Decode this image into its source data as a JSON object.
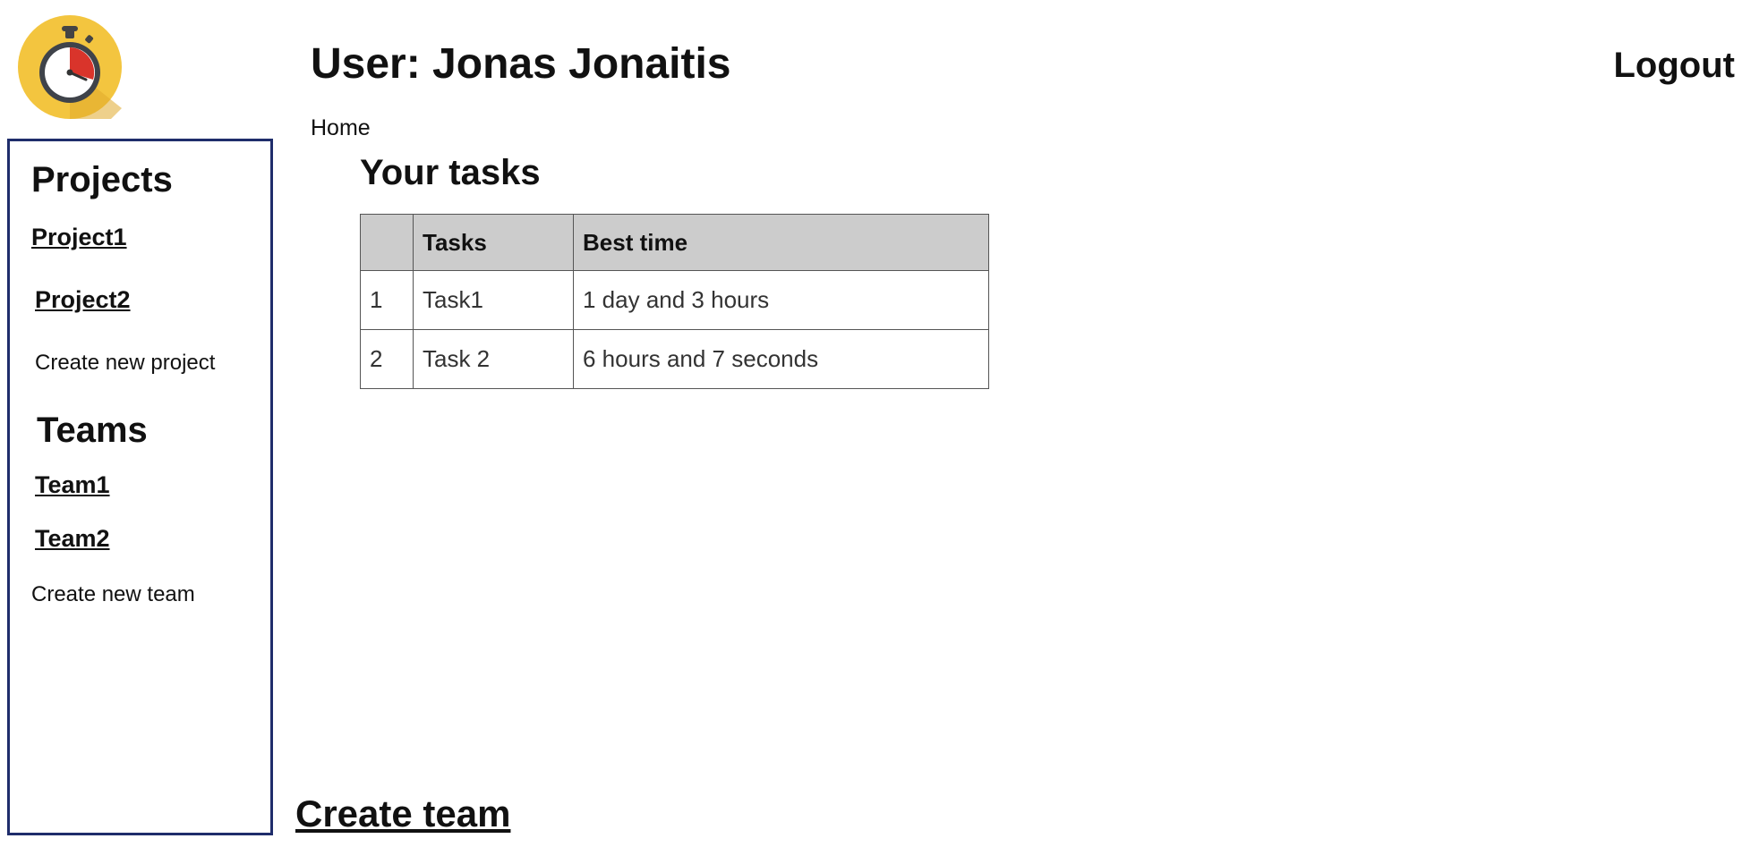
{
  "header": {
    "user_title": "User: Jonas Jonaitis",
    "logout_label": "Logout"
  },
  "breadcrumb": {
    "home_label": "Home"
  },
  "logo": {
    "icon": "stopwatch-icon",
    "bg_color": "#f3c53f",
    "accent_color": "#d9342b"
  },
  "sidebar": {
    "projects_heading": "Projects",
    "projects": [
      {
        "label": "Project1"
      },
      {
        "label": "Project2"
      }
    ],
    "create_project_label": "Create new project",
    "teams_heading": "Teams",
    "teams": [
      {
        "label": "Team1"
      },
      {
        "label": "Team2"
      }
    ],
    "create_team_label": "Create new team",
    "border_color": "#1f2d6b"
  },
  "main": {
    "title": "Your tasks",
    "table": {
      "headers": [
        "",
        "Tasks",
        "Best time"
      ],
      "rows": [
        [
          "1",
          "Task1",
          "1 day and 3 hours"
        ],
        [
          "2",
          "Task 2",
          "6 hours and 7 seconds"
        ]
      ]
    },
    "create_team_label": "Create team"
  }
}
